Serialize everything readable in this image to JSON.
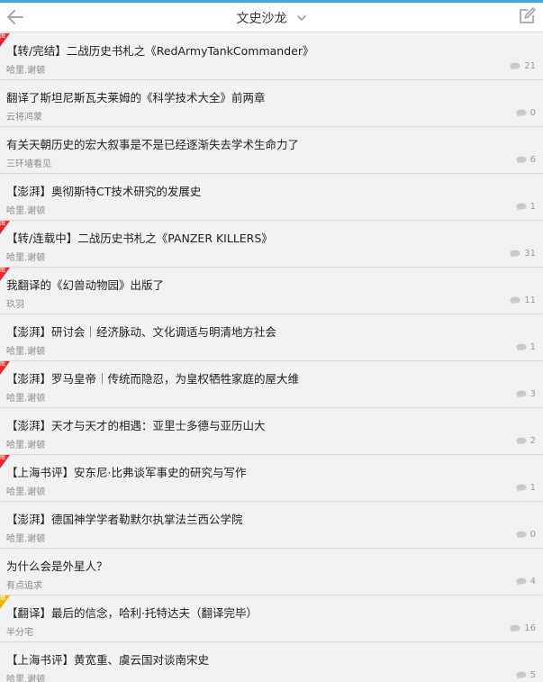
{
  "header": {
    "title": "文史沙龙"
  },
  "colors": {
    "accent": "#3fa9d9",
    "tag_red": "#e8262b",
    "tag_yellow": "#f6b400"
  },
  "threads": [
    {
      "title": "【转/完结】二战历史书札之《RedArmyTankCommander》",
      "author": "哈里.谢顿",
      "replies": "21",
      "tag": "red",
      "tag_text": "图"
    },
    {
      "title": "翻译了斯坦尼斯瓦夫莱姆的《科学技术大全》前两章",
      "author": "云将鸿蒙",
      "replies": "0",
      "tag": "",
      "tag_text": ""
    },
    {
      "title": "有关天朝历史的宏大叙事是不是已经逐渐失去学术生命力了",
      "author": "三环墙看见",
      "replies": "6",
      "tag": "",
      "tag_text": ""
    },
    {
      "title": "【澎湃】奥彻斯特CT技术研究的发展史",
      "author": "哈里.谢顿",
      "replies": "1",
      "tag": "",
      "tag_text": ""
    },
    {
      "title": "【转/连载中】二战历史书札之《PANZER KILLERS》",
      "author": "哈里.谢顿",
      "replies": "31",
      "tag": "red",
      "tag_text": "图"
    },
    {
      "title": "我翻译的《幻兽动物园》出版了",
      "author": "玖羽",
      "replies": "11",
      "tag": "red",
      "tag_text": "图"
    },
    {
      "title": "【澎湃】研讨会｜经济脉动、文化调适与明清地方社会",
      "author": "哈里.谢顿",
      "replies": "1",
      "tag": "",
      "tag_text": ""
    },
    {
      "title": "【澎湃】罗马皇帝｜传统而隐忍，为皇权牺牲家庭的屋大维",
      "author": "哈里.谢顿",
      "replies": "3",
      "tag": "red",
      "tag_text": "图"
    },
    {
      "title": "【澎湃】天才与天才的相遇：亚里士多德与亚历山大",
      "author": "哈里.谢顿",
      "replies": "2",
      "tag": "",
      "tag_text": ""
    },
    {
      "title": "【上海书评】安东尼·比弗谈军事史的研究与写作",
      "author": "哈里.谢顿",
      "replies": "1",
      "tag": "red",
      "tag_text": "图"
    },
    {
      "title": "【澎湃】德国神学学者勒默尔执掌法兰西公学院",
      "author": "哈里.谢顿",
      "replies": "0",
      "tag": "",
      "tag_text": ""
    },
    {
      "title": "为什么会是外星人？",
      "author": "有点追求",
      "replies": "4",
      "tag": "",
      "tag_text": ""
    },
    {
      "title": "【翻译】最后的信念，哈利·托特达夫（翻译完毕）",
      "author": "半分宅",
      "replies": "16",
      "tag": "yellow",
      "tag_text": "精"
    },
    {
      "title": "【上海书评】黄宽重、虞云国对谈南宋史",
      "author": "哈里.谢顿",
      "replies": "5",
      "tag": "",
      "tag_text": ""
    }
  ]
}
